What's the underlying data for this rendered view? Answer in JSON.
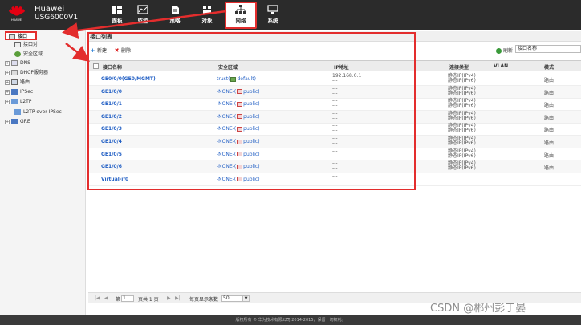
{
  "header": {
    "logo_text": "HUAWEI",
    "brand_line1": "Huawei",
    "brand_line2": "USG6000V1",
    "nav": [
      {
        "label": "面板",
        "icon": "dashboard-icon"
      },
      {
        "label": "监控",
        "icon": "monitor-icon"
      },
      {
        "label": "策略",
        "icon": "policy-icon"
      },
      {
        "label": "对象",
        "icon": "object-icon"
      },
      {
        "label": "网络",
        "icon": "network-icon"
      },
      {
        "label": "系统",
        "icon": "system-icon"
      }
    ],
    "active_nav": "网络"
  },
  "sidebar": {
    "items": [
      {
        "label": "接口",
        "icon": "interface-icon",
        "expander": ""
      },
      {
        "label": "接口对",
        "icon": "interface-pair-icon",
        "expander": ""
      },
      {
        "label": "安全区域",
        "icon": "security-zone-icon",
        "expander": ""
      },
      {
        "label": "DNS",
        "icon": "dns-icon",
        "expander": "+"
      },
      {
        "label": "DHCP服务器",
        "icon": "dhcp-icon",
        "expander": "+"
      },
      {
        "label": "路由",
        "icon": "route-icon",
        "expander": "+"
      },
      {
        "label": "IPSec",
        "icon": "ipsec-icon",
        "expander": "+"
      },
      {
        "label": "L2TP",
        "icon": "l2tp-icon",
        "expander": "+"
      },
      {
        "label": "L2TP over IPSec",
        "icon": "l2tp-ipsec-icon",
        "expander": ""
      },
      {
        "label": "GRE",
        "icon": "gre-icon",
        "expander": "+"
      }
    ]
  },
  "main": {
    "title": "接口列表",
    "toolbar": {
      "new_label": "新建",
      "delete_label": "删除",
      "refresh_label": "刷新",
      "search_field": "接口名称"
    },
    "columns": [
      "接口名称",
      "安全区域",
      "IP地址",
      "连接类型",
      "VLAN",
      "模式"
    ],
    "rows": [
      {
        "name": "GE0/0/0(GE0/MGMT)",
        "zone_prefix": "trust(",
        "zone_suffix": "default)",
        "zone_icon": "green",
        "ip1": "192.168.0.1",
        "ip2": "---",
        "conn1": "静态IP(IPv4)",
        "conn2": "静态IP(IPv6)",
        "mode": "路由"
      },
      {
        "name": "GE1/0/0",
        "zone_prefix": "-NONE-(",
        "zone_suffix": "public)",
        "zone_icon": "red",
        "ip1": "---",
        "ip2": "---",
        "conn1": "静态IP(IPv4)",
        "conn2": "静态IP(IPv6)",
        "mode": "路由"
      },
      {
        "name": "GE1/0/1",
        "zone_prefix": "-NONE-(",
        "zone_suffix": "public)",
        "zone_icon": "red",
        "ip1": "---",
        "ip2": "---",
        "conn1": "静态IP(IPv4)",
        "conn2": "静态IP(IPv6)",
        "mode": "路由"
      },
      {
        "name": "GE1/0/2",
        "zone_prefix": "-NONE-(",
        "zone_suffix": "public)",
        "zone_icon": "red",
        "ip1": "---",
        "ip2": "---",
        "conn1": "静态IP(IPv4)",
        "conn2": "静态IP(IPv6)",
        "mode": "路由"
      },
      {
        "name": "GE1/0/3",
        "zone_prefix": "-NONE-(",
        "zone_suffix": "public)",
        "zone_icon": "red",
        "ip1": "---",
        "ip2": "---",
        "conn1": "静态IP(IPv4)",
        "conn2": "静态IP(IPv6)",
        "mode": "路由"
      },
      {
        "name": "GE1/0/4",
        "zone_prefix": "-NONE-(",
        "zone_suffix": "public)",
        "zone_icon": "red",
        "ip1": "---",
        "ip2": "---",
        "conn1": "静态IP(IPv4)",
        "conn2": "静态IP(IPv6)",
        "mode": "路由"
      },
      {
        "name": "GE1/0/5",
        "zone_prefix": "-NONE-(",
        "zone_suffix": "public)",
        "zone_icon": "red",
        "ip1": "---",
        "ip2": "---",
        "conn1": "静态IP(IPv4)",
        "conn2": "静态IP(IPv6)",
        "mode": "路由"
      },
      {
        "name": "GE1/0/6",
        "zone_prefix": "-NONE-(",
        "zone_suffix": "public)",
        "zone_icon": "red",
        "ip1": "---",
        "ip2": "---",
        "conn1": "静态IP(IPv4)",
        "conn2": "静态IP(IPv6)",
        "mode": "路由"
      },
      {
        "name": "Virtual-if0",
        "zone_prefix": "-NONE-(",
        "zone_suffix": "public)",
        "zone_icon": "red",
        "ip1": "---",
        "ip2": "",
        "conn1": "",
        "conn2": "",
        "mode": ""
      }
    ],
    "pager": {
      "first": "|◀",
      "prev": "◀",
      "page_prefix": "第",
      "page_value": "1",
      "page_suffix": "页共 1 页",
      "next": "▶",
      "last": "▶|",
      "per_page_label": "每页显示条数",
      "per_page_value": "50"
    }
  },
  "footer": {
    "text": "版权所有 © 华为技术有限公司 2014-2015，保留一切权利。"
  },
  "watermark": "CSDN @郴州彭于晏",
  "colors": {
    "accent_red": "#e32d2d",
    "link_blue": "#2461c5",
    "header_bg": "#2b2b2b"
  }
}
